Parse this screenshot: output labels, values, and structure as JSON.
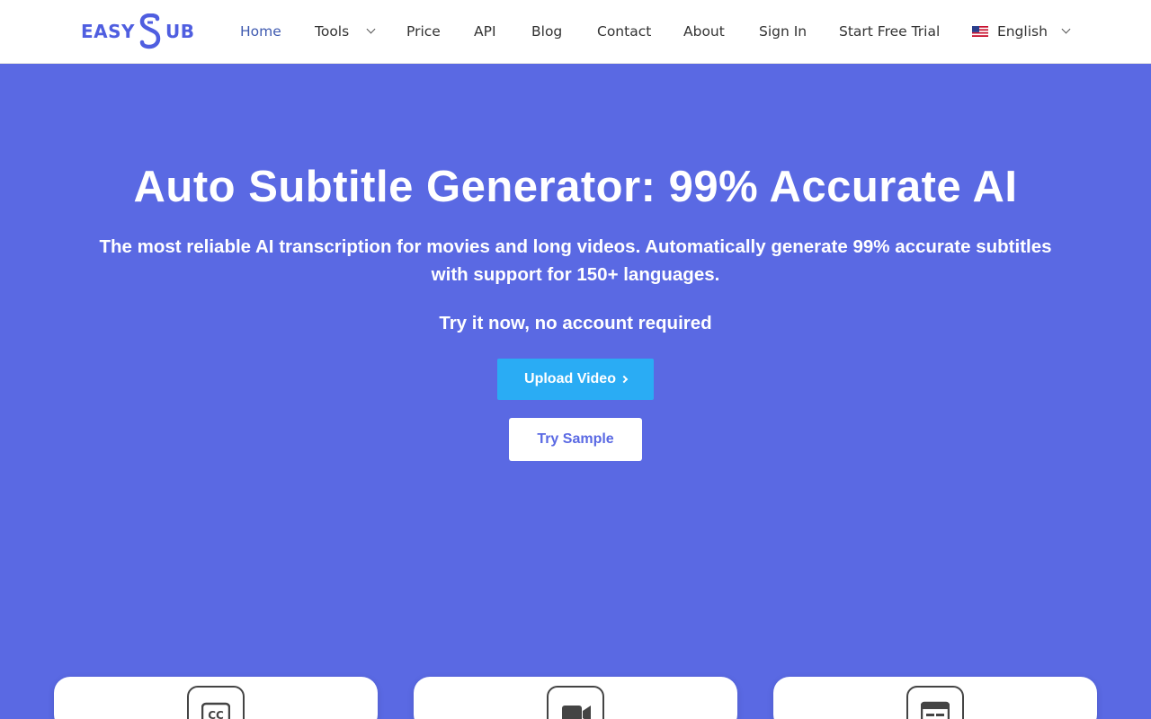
{
  "brand": {
    "logo_left": "EASY",
    "logo_right": "UB",
    "logo_color": "#4f5ee0"
  },
  "nav": {
    "items": [
      {
        "label": "Home",
        "active": true
      },
      {
        "label": "Tools",
        "has_dropdown": true
      },
      {
        "label": "Price"
      },
      {
        "label": "API"
      },
      {
        "label": "Blog"
      },
      {
        "label": "Contact"
      },
      {
        "label": "About"
      },
      {
        "label": "Sign In"
      },
      {
        "label": "Start Free Trial"
      }
    ],
    "language": {
      "label": "English",
      "flag_icon": "us-flag-icon"
    }
  },
  "hero": {
    "title": "Auto Subtitle Generator: 99% Accurate AI",
    "subtitle_line1": "The most reliable AI transcription for movies and long videos. Automatically generate 99% accurate subtitles",
    "subtitle_line2": "with support for 150+ languages.",
    "try_text": "Try it now, no account required",
    "upload_label": "Upload Video",
    "sample_label": "Try Sample",
    "background": "#5a69e3",
    "upload_color": "#2aacf4"
  },
  "feature_cards": [
    {
      "icon": "closed-captions-icon"
    },
    {
      "icon": "video-camera-icon"
    },
    {
      "icon": "subtitle-editor-icon"
    }
  ]
}
